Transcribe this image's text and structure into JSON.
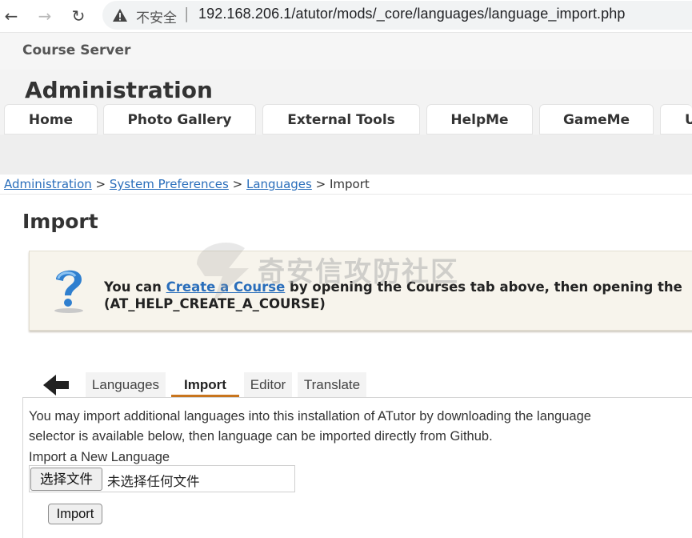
{
  "browser": {
    "insecure_label": "不安全",
    "separator": "|",
    "url": "192.168.206.1/atutor/mods/_core/languages/language_import.php",
    "icons": [
      "back-arrow-icon",
      "forward-arrow-icon",
      "reload-icon",
      "warning-icon"
    ]
  },
  "site": {
    "name": "Course Server",
    "section_title": "Administration",
    "main_tabs": [
      "Home",
      "Photo Gallery",
      "External Tools",
      "HelpMe",
      "GameMe",
      "U"
    ]
  },
  "breadcrumb": {
    "items": [
      "Administration",
      "System Preferences",
      "Languages"
    ],
    "separator": ">",
    "current": "Import"
  },
  "page": {
    "title": "Import"
  },
  "help": {
    "icon": "question-mark-icon",
    "prefix": "You can ",
    "link": "Create a Course",
    "suffix": " by opening the Courses tab above, then opening the",
    "code": "(AT_HELP_CREATE_A_COURSE)"
  },
  "watermark": {
    "text": "奇安信攻防社区"
  },
  "subtabs": {
    "back_icon": "back-arrow-icon",
    "items": [
      "Languages",
      "Import",
      "Editor",
      "Translate"
    ],
    "active": "Import"
  },
  "form": {
    "description_line1": "You may import additional languages into this installation of ATutor by downloading the language",
    "description_line2": "selector is available below, then language can be imported directly from Github.",
    "field_label": "Import a New Language",
    "file_button": "选择文件",
    "file_status": "未选择任何文件",
    "submit_label": "Import"
  },
  "colors": {
    "link": "#2a6ebb",
    "active_tab_underline": "#c8751e",
    "help_background": "#f7f4ec"
  }
}
